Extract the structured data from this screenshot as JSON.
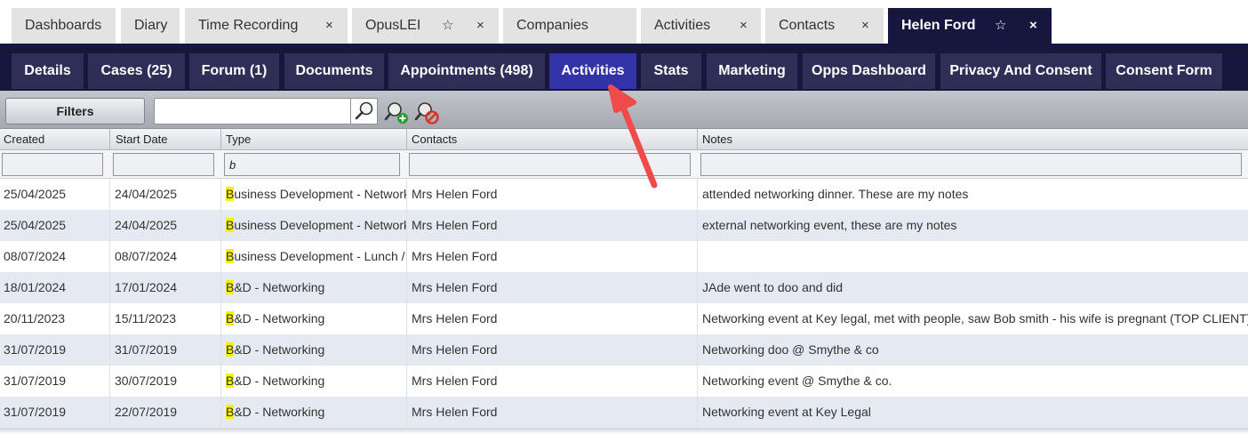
{
  "top_tabs": [
    {
      "label": "Dashboards"
    },
    {
      "label": "Diary"
    },
    {
      "label": "Time Recording",
      "close": "×"
    },
    {
      "label": "OpusLEI",
      "star": "☆",
      "close": "×"
    },
    {
      "label": "Companies",
      "close": "×"
    },
    {
      "label": "Activities",
      "close": "×"
    },
    {
      "label": "Contacts",
      "close": "×"
    },
    {
      "label": "Helen Ford",
      "star": "☆",
      "close": "×",
      "active": true
    }
  ],
  "sub_tabs": [
    {
      "label": "Details"
    },
    {
      "label": "Cases (25)"
    },
    {
      "label": "Forum (1)"
    },
    {
      "label": "Documents"
    },
    {
      "label": "Appointments (498)"
    },
    {
      "label": "Activities",
      "active": true
    },
    {
      "label": "Stats"
    },
    {
      "label": "Marketing"
    },
    {
      "label": "Opps Dashboard"
    },
    {
      "label": "Privacy And Consent"
    },
    {
      "label": "Consent Form"
    }
  ],
  "toolbar": {
    "filters_label": "Filters",
    "search_value": "",
    "search_icon": "magnifier-icon",
    "add_icon": "add-filter-icon",
    "clear_icon": "clear-filter-icon"
  },
  "grid": {
    "columns": [
      "Created",
      "Start Date",
      "Type",
      "Contacts",
      "Notes"
    ],
    "filters": {
      "created": "",
      "start_date": "",
      "type": "b",
      "contacts": "",
      "notes": ""
    },
    "rows": [
      {
        "created": "25/04/2025",
        "start_date": "24/04/2025",
        "type_hl": "B",
        "type_rest": "usiness Development - Network",
        "contacts": "Mrs Helen Ford",
        "notes": "attended networking dinner. These are my notes"
      },
      {
        "created": "25/04/2025",
        "start_date": "24/04/2025",
        "type_hl": "B",
        "type_rest": "usiness Development - Network",
        "contacts": "Mrs Helen Ford",
        "notes": "external networking event, these are my notes"
      },
      {
        "created": "08/07/2024",
        "start_date": "08/07/2024",
        "type_hl": "B",
        "type_rest": "usiness Development - Lunch /",
        "contacts": "Mrs Helen Ford",
        "notes": ""
      },
      {
        "created": "18/01/2024",
        "start_date": "17/01/2024",
        "type_hl": "B",
        "type_rest": "&D - Networking",
        "contacts": "Mrs Helen Ford",
        "notes": "JAde went to doo and did"
      },
      {
        "created": "20/11/2023",
        "start_date": "15/11/2023",
        "type_hl": "B",
        "type_rest": "&D - Networking",
        "contacts": "Mrs Helen Ford",
        "notes": "Networking event at Key legal, met with people, saw Bob smith - his wife is pregnant (TOP CLIENT),"
      },
      {
        "created": "31/07/2019",
        "start_date": "31/07/2019",
        "type_hl": "B",
        "type_rest": "&D - Networking",
        "contacts": "Mrs Helen Ford",
        "notes": "Networking doo @ Smythe & co"
      },
      {
        "created": "31/07/2019",
        "start_date": "30/07/2019",
        "type_hl": "B",
        "type_rest": "&D - Networking",
        "contacts": "Mrs Helen Ford",
        "notes": "Networking event @ Smythe & co."
      },
      {
        "created": "31/07/2019",
        "start_date": "22/07/2019",
        "type_hl": "B",
        "type_rest": "&D - Networking",
        "contacts": "Mrs Helen Ford",
        "notes": "Networking event at Key Legal"
      }
    ]
  },
  "colors": {
    "nav_dark": "#16163f",
    "tab_inactive": "#2e2e57",
    "tab_active": "#3333a8",
    "highlight": "#f2f20a",
    "arrow": "#f04a4a"
  }
}
